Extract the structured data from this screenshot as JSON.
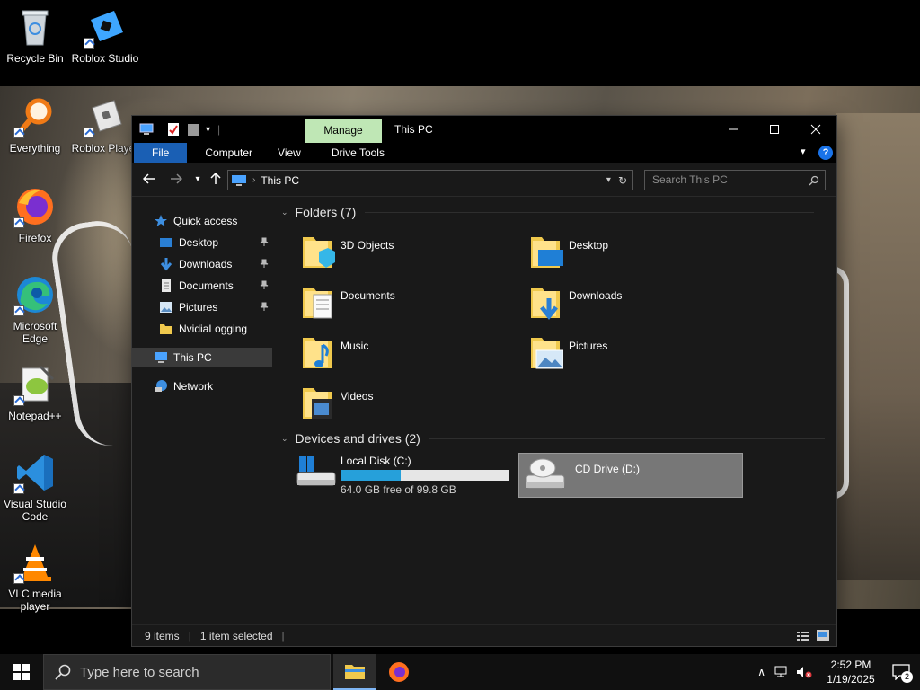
{
  "desktop": {
    "icons": [
      {
        "label": "Recycle Bin"
      },
      {
        "label": "Roblox Studio"
      },
      {
        "label": "Everything"
      },
      {
        "label": "Roblox Player"
      },
      {
        "label": "Firefox"
      },
      {
        "label": "Microsoft Edge"
      },
      {
        "label": "Notepad++"
      },
      {
        "label": "Visual Studio Code"
      },
      {
        "label": "VLC media player"
      }
    ]
  },
  "window": {
    "title": "This PC",
    "manage_tab": "Manage",
    "ribbon_tabs": [
      "File",
      "Computer",
      "View",
      "Drive Tools"
    ],
    "address": {
      "location": "This PC"
    },
    "search": {
      "placeholder": "Search This PC"
    },
    "nav": {
      "quick_access": "Quick access",
      "items": [
        "Desktop",
        "Downloads",
        "Documents",
        "Pictures",
        "NvidiaLogging"
      ],
      "this_pc": "This PC",
      "network": "Network"
    },
    "folders": {
      "header": "Folders (7)",
      "items": [
        "3D Objects",
        "Desktop",
        "Documents",
        "Downloads",
        "Music",
        "Pictures",
        "Videos"
      ]
    },
    "devices": {
      "header": "Devices and drives (2)",
      "local_disk": {
        "name": "Local Disk (C:)",
        "free_text": "64.0 GB free of 99.8 GB",
        "used_fraction": 0.359
      },
      "cd_drive": {
        "name": "CD Drive (D:)"
      }
    },
    "status": {
      "items": "9 items",
      "selected": "1 item selected"
    }
  },
  "taskbar": {
    "search_placeholder": "Type here to search",
    "time": "2:52 PM",
    "date": "1/19/2025",
    "notification_count": "2"
  },
  "colors": {
    "accent": "#1a5fb4",
    "manage_tab": "#bfe7b5",
    "progress_fill": "#26a0da"
  }
}
